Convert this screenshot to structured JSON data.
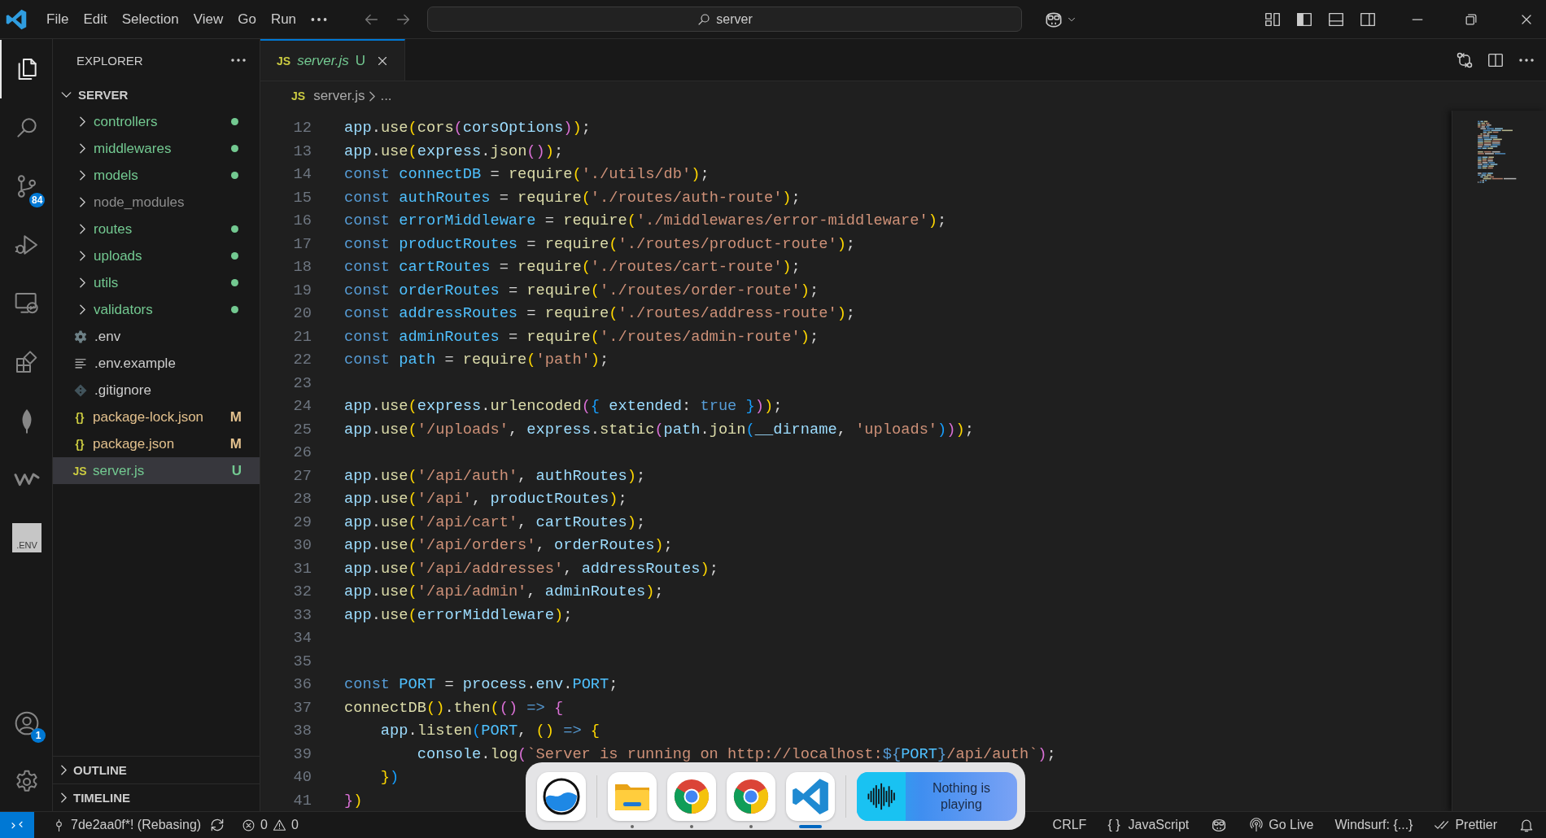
{
  "title_bar": {
    "menus": [
      "File",
      "Edit",
      "Selection",
      "View",
      "Go",
      "Run"
    ],
    "search": {
      "value": "server"
    }
  },
  "activity_bar": {
    "items": [
      {
        "kind": "explorer",
        "selected": true
      },
      {
        "kind": "search",
        "selected": false
      },
      {
        "kind": "source-control",
        "selected": false,
        "badge": "84"
      },
      {
        "kind": "run-debug",
        "selected": false
      },
      {
        "kind": "remote",
        "selected": false
      },
      {
        "kind": "extensions",
        "selected": false
      },
      {
        "kind": "leaf",
        "selected": false
      },
      {
        "kind": "wave",
        "selected": false
      },
      {
        "kind": "tile",
        "selected": false,
        "label": ".ENV"
      }
    ],
    "bottom": [
      {
        "kind": "account",
        "badge": "1"
      },
      {
        "kind": "settings"
      }
    ]
  },
  "sidebar": {
    "title": "EXPLORER",
    "section": {
      "title": "SERVER",
      "expanded": true,
      "items": [
        {
          "label": "controllers",
          "kind": "folder",
          "expanded": false,
          "color": "#73c991",
          "dot": true,
          "selected": false
        },
        {
          "label": "middlewares",
          "kind": "folder",
          "expanded": false,
          "color": "#73c991",
          "dot": true,
          "selected": false
        },
        {
          "label": "models",
          "kind": "folder",
          "expanded": false,
          "color": "#73c991",
          "dot": true,
          "selected": false
        },
        {
          "label": "node_modules",
          "kind": "folder",
          "expanded": false,
          "color": "#8c8c8c",
          "dot": false,
          "selected": false
        },
        {
          "label": "routes",
          "kind": "folder",
          "expanded": false,
          "color": "#73c991",
          "dot": true,
          "selected": false
        },
        {
          "label": "uploads",
          "kind": "folder",
          "expanded": false,
          "color": "#73c991",
          "dot": true,
          "selected": false
        },
        {
          "label": "utils",
          "kind": "folder",
          "expanded": false,
          "color": "#73c991",
          "dot": true,
          "selected": false
        },
        {
          "label": "validators",
          "kind": "folder",
          "expanded": false,
          "color": "#73c991",
          "dot": true,
          "selected": false
        },
        {
          "label": ".env",
          "kind": "settings-file",
          "color": "#cccccc",
          "dot": false,
          "selected": false
        },
        {
          "label": ".env.example",
          "kind": "text-file",
          "color": "#cccccc",
          "dot": false,
          "selected": false
        },
        {
          "label": ".gitignore",
          "kind": "git-file",
          "color": "#cccccc",
          "dot": false,
          "selected": false
        },
        {
          "label": "package-lock.json",
          "kind": "json",
          "icon_text": "{}",
          "color": "#e2c08d",
          "dot": false,
          "badge": "M",
          "selected": false
        },
        {
          "label": "package.json",
          "kind": "json",
          "icon_text": "{}",
          "color": "#e2c08d",
          "dot": false,
          "badge": "M",
          "selected": false
        },
        {
          "label": "server.js",
          "kind": "js",
          "icon_text": "JS",
          "color": "#73c991",
          "dot": false,
          "badge": "U",
          "selected": true
        }
      ]
    },
    "panels": [
      {
        "title": "OUTLINE",
        "expanded": false
      },
      {
        "title": "TIMELINE",
        "expanded": false
      }
    ]
  },
  "editor": {
    "tabs": [
      {
        "icon_text": "JS",
        "label": "server.js",
        "color": "#73c991",
        "badge": "U",
        "selected": true
      }
    ],
    "breadcrumb": [
      {
        "icon_text": "JS",
        "label": "server.js"
      },
      {
        "label": "..."
      }
    ],
    "lines": [
      {
        "number": "12",
        "text": "app.use(cors(corsOptions));"
      },
      {
        "number": "13",
        "text": "app.use(express.json());"
      },
      {
        "number": "14",
        "text": "const connectDB = require('./utils/db');"
      },
      {
        "number": "15",
        "text": "const authRoutes = require('./routes/auth-route');"
      },
      {
        "number": "16",
        "text": "const errorMiddleware = require('./middlewares/error-middleware');"
      },
      {
        "number": "17",
        "text": "const productRoutes = require('./routes/product-route');"
      },
      {
        "number": "18",
        "text": "const cartRoutes = require('./routes/cart-route');"
      },
      {
        "number": "19",
        "text": "const orderRoutes = require('./routes/order-route');"
      },
      {
        "number": "20",
        "text": "const addressRoutes = require('./routes/address-route');"
      },
      {
        "number": "21",
        "text": "const adminRoutes = require('./routes/admin-route');"
      },
      {
        "number": "22",
        "text": "const path = require('path');"
      },
      {
        "number": "23"
      },
      {
        "number": "24",
        "text": "app.use(express.urlencoded({ extended: true }));"
      },
      {
        "number": "25",
        "text": "app.use('/uploads', express.static(path.join(__dirname, 'uploads')));"
      },
      {
        "number": "26"
      },
      {
        "number": "27",
        "text": "app.use('/api/auth', authRoutes);"
      },
      {
        "number": "28",
        "text": "app.use('/api', productRoutes);"
      },
      {
        "number": "29",
        "text": "app.use('/api/cart', cartRoutes);"
      },
      {
        "number": "30",
        "text": "app.use('/api/orders', orderRoutes);"
      },
      {
        "number": "31",
        "text": "app.use('/api/addresses', addressRoutes);"
      },
      {
        "number": "32",
        "text": "app.use('/api/admin', adminRoutes);"
      },
      {
        "number": "33",
        "text": "app.use(errorMiddleware);"
      },
      {
        "number": "34"
      },
      {
        "number": "35"
      },
      {
        "number": "36",
        "text": "const PORT = process.env.PORT;"
      },
      {
        "number": "37",
        "text": "connectDB().then(() => {"
      },
      {
        "number": "38",
        "text": "    app.listen(PORT, () => {"
      },
      {
        "number": "39",
        "text": "        console.log(`Server is running on http://localhost:${PORT}/api/auth`);"
      },
      {
        "number": "40",
        "text": "    })"
      },
      {
        "number": "41",
        "text": "})"
      }
    ]
  },
  "status_bar": {
    "left": [
      {
        "kind": "remote"
      },
      {
        "kind": "branch",
        "text": "7de2aa0f*! (Rebasing)"
      },
      {
        "kind": "sync"
      },
      {
        "kind": "problems",
        "errors": "0",
        "warnings": "0"
      }
    ],
    "right": [
      {
        "kind": "text",
        "text": "CRLF"
      },
      {
        "kind": "language",
        "icon_text": "{ }",
        "text": "JavaScript"
      },
      {
        "kind": "copilot"
      },
      {
        "kind": "broadcast",
        "text": "Go Live"
      },
      {
        "kind": "text",
        "text": "Windsurf: {...}"
      },
      {
        "kind": "check",
        "text": "Prettier"
      },
      {
        "kind": "bell"
      }
    ]
  },
  "dock": {
    "items": [
      {
        "kind": "water",
        "running": false,
        "focused": false
      },
      {
        "kind": "folder",
        "running": true,
        "focused": false
      },
      {
        "kind": "browser",
        "running": true,
        "focused": false
      },
      {
        "kind": "browser",
        "running": true,
        "focused": false
      },
      {
        "kind": "code",
        "running": true,
        "focused": true
      }
    ],
    "media": {
      "text": "Nothing is playing"
    }
  }
}
